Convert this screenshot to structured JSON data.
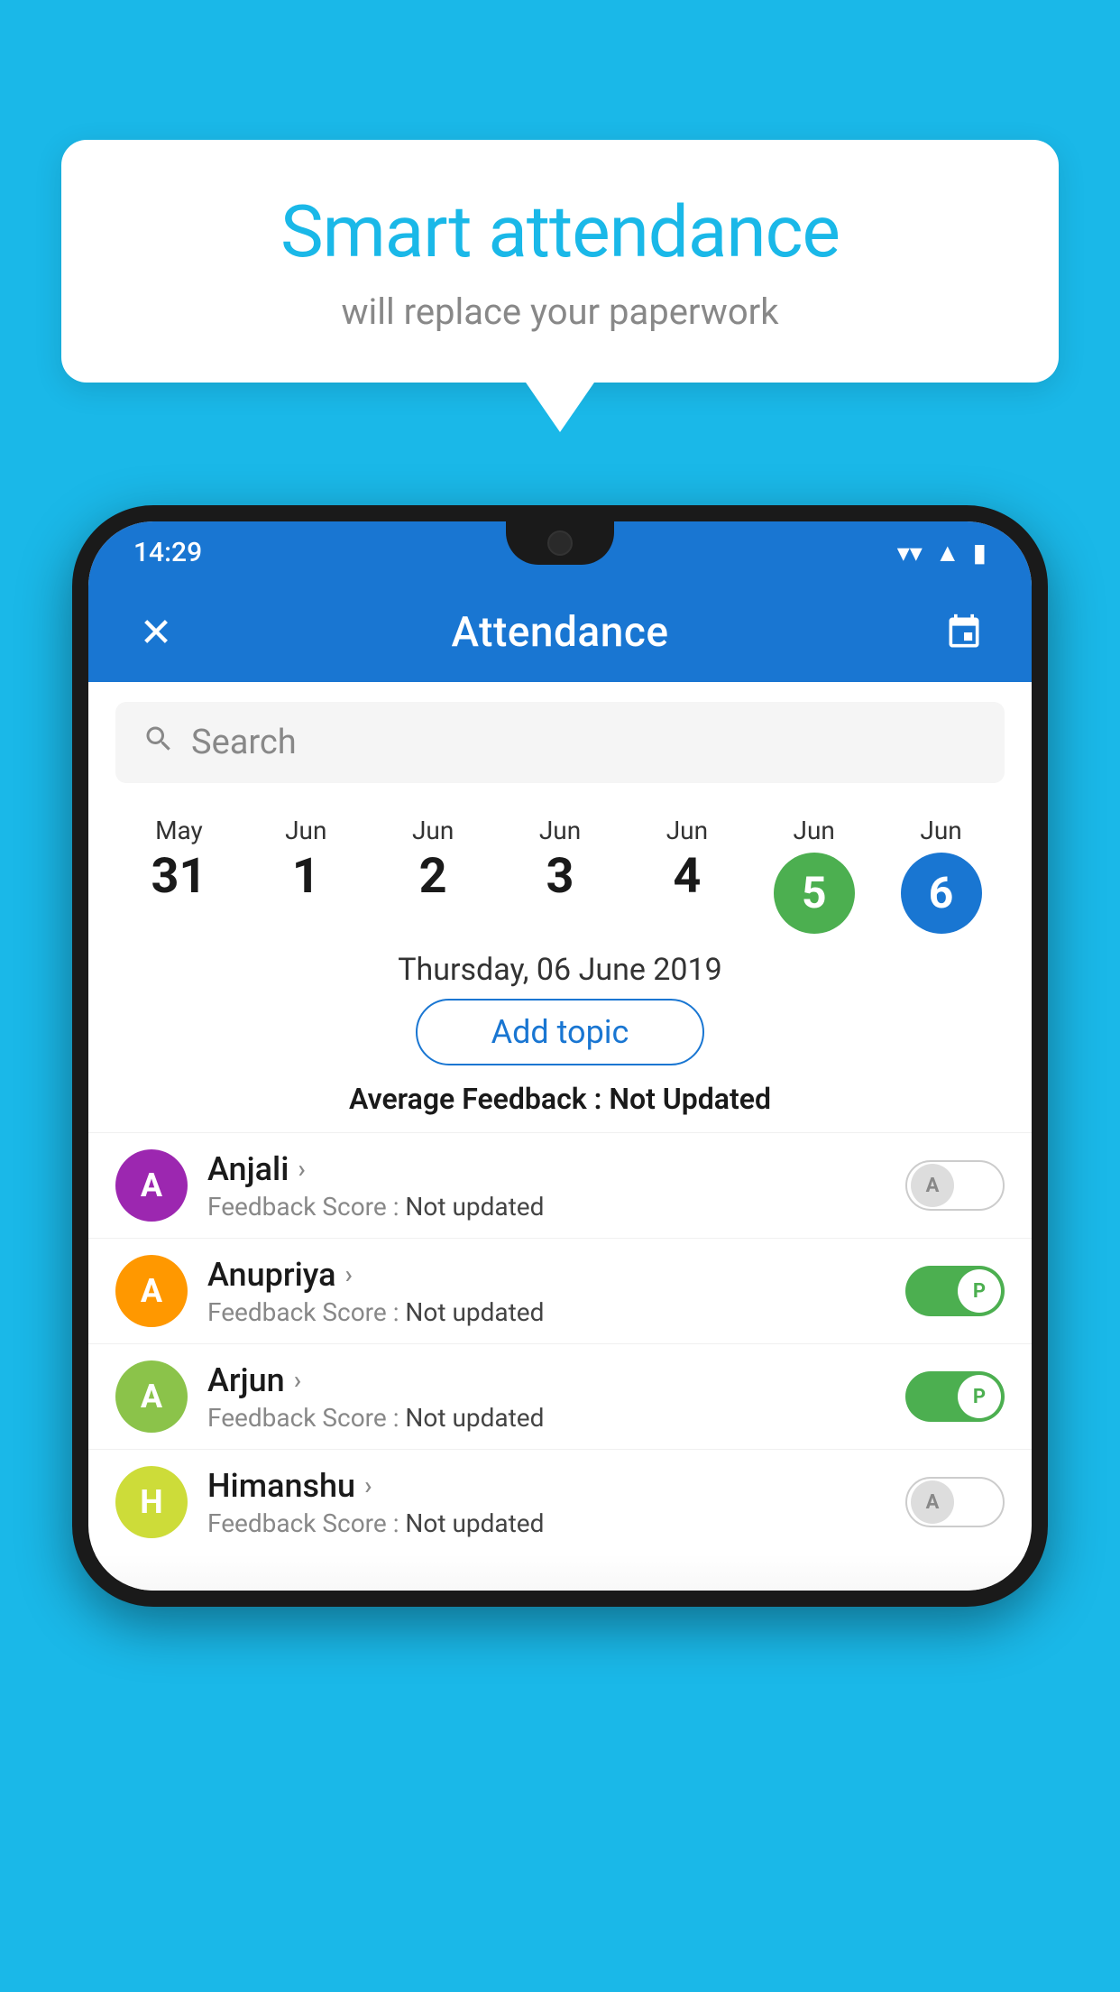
{
  "background_color": "#1ab8e8",
  "speech_bubble": {
    "title": "Smart attendance",
    "subtitle": "will replace your paperwork"
  },
  "status_bar": {
    "time": "14:29",
    "wifi": "▼",
    "signal": "▲",
    "battery": "▮"
  },
  "app_bar": {
    "title": "Attendance",
    "close_icon": "close-icon",
    "calendar_icon": "calendar-icon"
  },
  "search": {
    "placeholder": "Search"
  },
  "calendar": {
    "dates": [
      {
        "month": "May",
        "day": "31",
        "selected": false
      },
      {
        "month": "Jun",
        "day": "1",
        "selected": false
      },
      {
        "month": "Jun",
        "day": "2",
        "selected": false
      },
      {
        "month": "Jun",
        "day": "3",
        "selected": false
      },
      {
        "month": "Jun",
        "day": "4",
        "selected": false
      },
      {
        "month": "Jun",
        "day": "5",
        "selected": "green"
      },
      {
        "month": "Jun",
        "day": "6",
        "selected": "blue"
      }
    ],
    "selected_date_label": "Thursday, 06 June 2019"
  },
  "add_topic_button": "Add topic",
  "avg_feedback": {
    "label": "Average Feedback : ",
    "value": "Not Updated"
  },
  "students": [
    {
      "name": "Anjali",
      "avatar_letter": "A",
      "avatar_color": "purple",
      "feedback_label": "Feedback Score : ",
      "feedback_value": "Not updated",
      "status": "absent",
      "toggle_label": "A"
    },
    {
      "name": "Anupriya",
      "avatar_letter": "A",
      "avatar_color": "orange",
      "feedback_label": "Feedback Score : ",
      "feedback_value": "Not updated",
      "status": "present",
      "toggle_label": "P"
    },
    {
      "name": "Arjun",
      "avatar_letter": "A",
      "avatar_color": "green",
      "feedback_label": "Feedback Score : ",
      "feedback_value": "Not updated",
      "status": "present",
      "toggle_label": "P"
    },
    {
      "name": "Himanshu",
      "avatar_letter": "H",
      "avatar_color": "lime",
      "feedback_label": "Feedback Score : ",
      "feedback_value": "Not updated",
      "status": "absent",
      "toggle_label": "A"
    }
  ]
}
